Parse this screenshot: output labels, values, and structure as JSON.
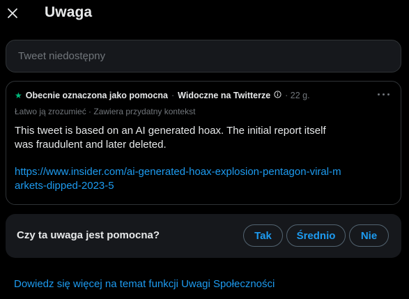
{
  "header": {
    "title": "Uwaga"
  },
  "tweet": {
    "placeholder": "Tweet niedostępny"
  },
  "note": {
    "status": "Obecnie oznaczona jako pomocna",
    "separator": "·",
    "visibility": "Widoczne na Twitterze",
    "age": "· 22 g.",
    "tags": "Łatwo ją zrozumieć · Zawiera przydatny kontekst",
    "body": "This tweet is based on an AI generated hoax. The initial report itself was fraudulent and later deleted.",
    "link": "https://www.insider.com/ai-generated-hoax-explosion-pentagon-viral-markets-dipped-2023-5"
  },
  "rating": {
    "question": "Czy ta uwaga jest pomocna?",
    "yes": "Tak",
    "somewhat": "Średnio",
    "no": "Nie"
  },
  "footer": {
    "learn_more": "Dowiedz się więcej na temat funkcji Uwagi Społeczności"
  },
  "colors": {
    "accent": "#1d9bf0",
    "helpful": "#00ba7c",
    "background": "#000000",
    "muted": "#71767b"
  },
  "icons": {
    "close": "close-icon",
    "star": "star-icon",
    "info": "info-icon",
    "more": "more-icon"
  }
}
